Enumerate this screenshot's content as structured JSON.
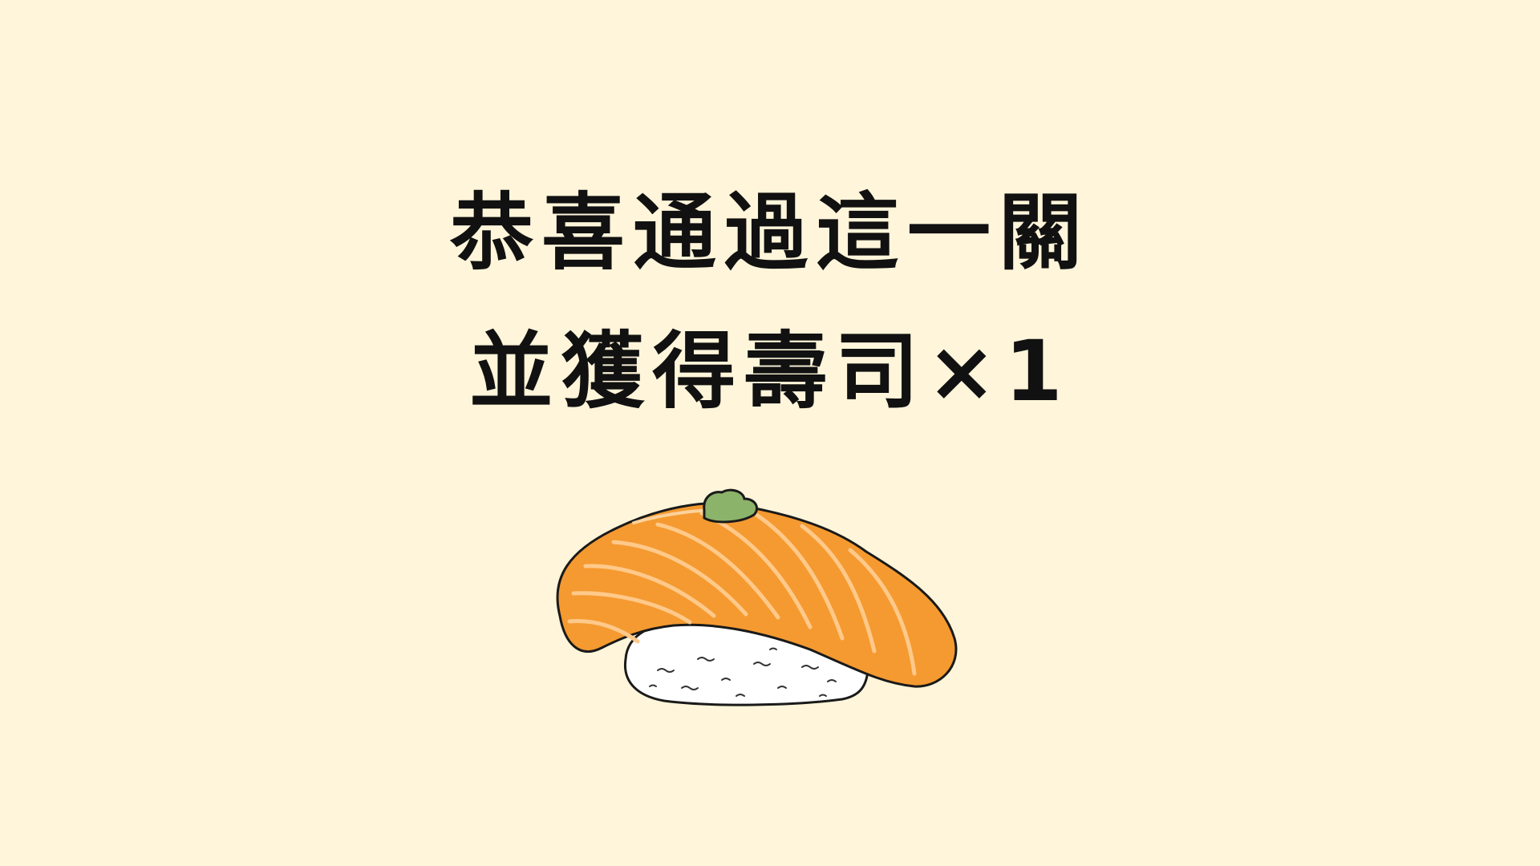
{
  "screen": "level-complete",
  "background_color": "#FEF5DA",
  "message": {
    "line1": "恭喜通過這一關",
    "line2": "並獲得壽司×1"
  },
  "reward": {
    "icon": "salmon-nigiri-icon",
    "salmon_color": "#F59A30",
    "rice_color": "#FFFFFF",
    "wasabi_color": "#8CB36A"
  }
}
